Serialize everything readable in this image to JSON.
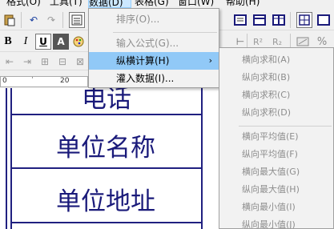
{
  "menubar": {
    "items": [
      {
        "label": "格式(O)"
      },
      {
        "label": "工具(T)"
      },
      {
        "label": "数据(D)"
      },
      {
        "label": "表格(G)"
      },
      {
        "label": "窗口(W)"
      },
      {
        "label": "帮助(H)"
      }
    ]
  },
  "toolbar2": {
    "bold": "B",
    "italic": "I",
    "underline": "U",
    "font_color": "A",
    "superscript": "R²",
    "subscript": "R₂",
    "percent": "%"
  },
  "ruler": {
    "left_mark": "0",
    "right_mark": "20"
  },
  "document": {
    "row_phone": "电话",
    "row_unit_name": "单位名称",
    "row_unit_address": "单位地址"
  },
  "data_menu": {
    "items": [
      {
        "label": "排序(O)...",
        "disabled": true
      },
      {
        "label": "输入公式(G)...",
        "disabled": true
      },
      {
        "label": "纵横计算(H)",
        "disabled": false,
        "highlighted": true,
        "has_submenu": true
      },
      {
        "label": "灌入数据(I)...",
        "disabled": false
      }
    ],
    "submenu_arrow": "›"
  },
  "calc_submenu": {
    "items": [
      {
        "label": "横向求和(A)"
      },
      {
        "label": "纵向求和(B)"
      },
      {
        "label": "横向求积(C)"
      },
      {
        "label": "纵向求积(D)"
      },
      {
        "label": "横向平均值(E)"
      },
      {
        "label": "纵向平均值(F)"
      },
      {
        "label": "横向最大值(G)"
      },
      {
        "label": "纵向最大值(H)"
      },
      {
        "label": "横向最小值(I)"
      },
      {
        "label": "纵向最小值(J)"
      }
    ]
  }
}
